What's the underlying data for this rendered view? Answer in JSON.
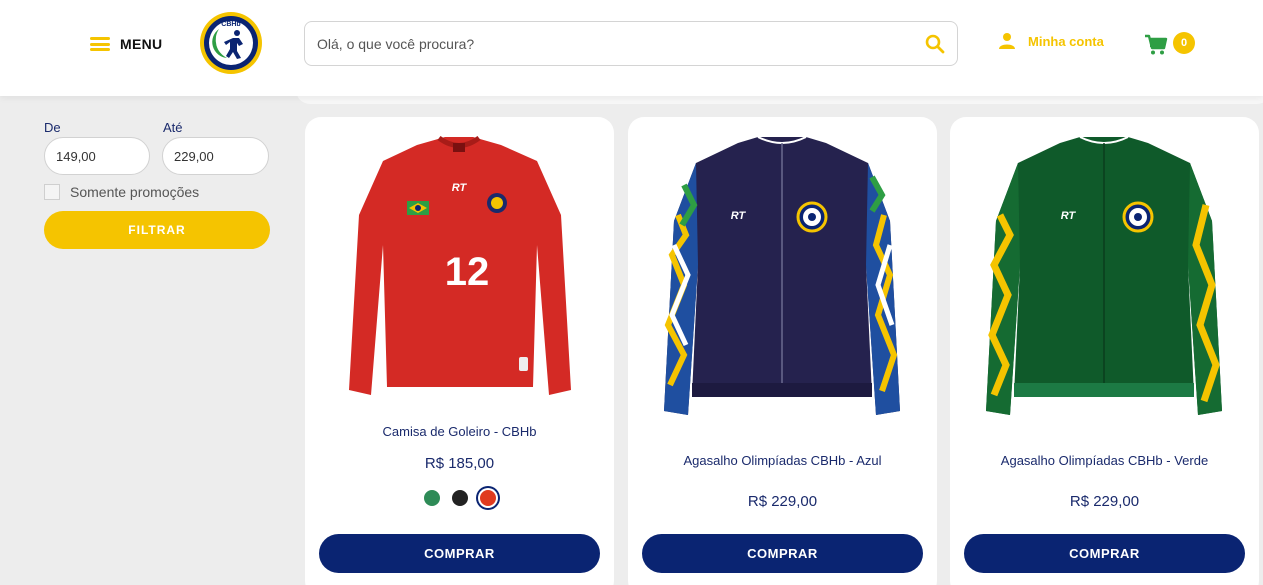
{
  "header": {
    "menu_label": "MENU",
    "logo_text": "CBHb",
    "search_placeholder": "Olá, o que você procura?",
    "account_label": "Minha conta",
    "cart_count": "0"
  },
  "filter": {
    "from_label": "De",
    "to_label": "Até",
    "from_value": "149,00",
    "to_value": "229,00",
    "promo_label": "Somente promoções",
    "filter_button": "FILTRAR"
  },
  "products": [
    {
      "name": "Camisa de Goleiro - CBHb",
      "price": "R$ 185,00",
      "buy_label": "COMPRAR",
      "shirt_number": "12",
      "swatches": [
        "#2e8b57",
        "#222222",
        "#e03a1e"
      ],
      "selected_swatch": 2
    },
    {
      "name": "Agasalho Olimpíadas CBHb - Azul",
      "price": "R$ 229,00",
      "buy_label": "COMPRAR"
    },
    {
      "name": "Agasalho Olimpíadas CBHb - Verde",
      "price": "R$ 229,00",
      "buy_label": "COMPRAR"
    }
  ],
  "colors": {
    "accent_yellow": "#f5c400",
    "navy": "#0a2472",
    "text_navy": "#1a2a6c"
  }
}
